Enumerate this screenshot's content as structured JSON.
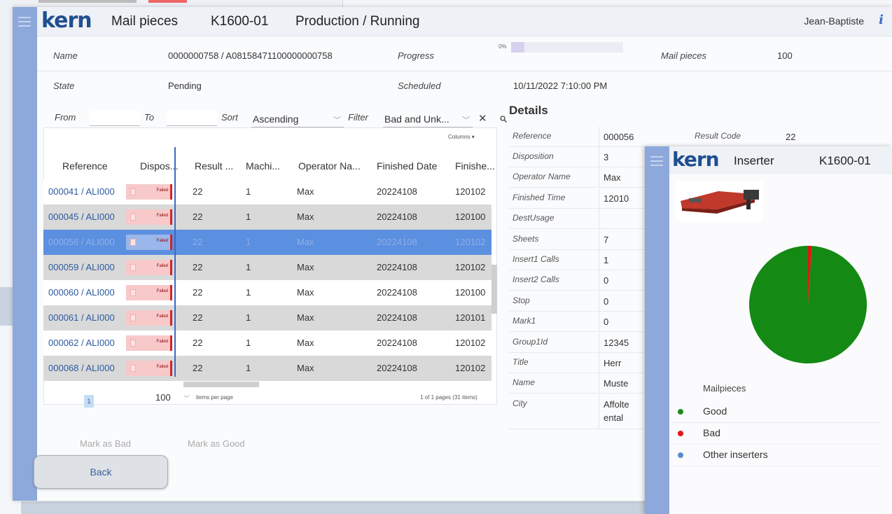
{
  "app": {
    "logo": "kern",
    "section": "Mail pieces",
    "machine": "K1600-01",
    "status": "Production / Running",
    "user": "Jean-Baptiste",
    "info_icon": "i"
  },
  "job": {
    "name_label": "Name",
    "name_value": "0000000758 / A08158471100000000758",
    "progress_label": "Progress",
    "progress_text": "0%",
    "progress_value": 0.12,
    "mailpieces_label": "Mail pieces",
    "mailpieces_value": "100",
    "state_label": "State",
    "state_value": "Pending",
    "scheduled_label": "Scheduled",
    "scheduled_value": "10/11/2022 7:10:00 PM"
  },
  "filter": {
    "from_label": "From",
    "to_label": "To",
    "sort_label": "Sort",
    "sort_value": "Ascending",
    "filter_label": "Filter",
    "filter_value": "Bad and Unk...",
    "clear_icon": "✕",
    "search_icon": "magnifier"
  },
  "grid": {
    "columns_button": "Columns",
    "headers": [
      "Reference",
      "Dispos...",
      "Result ...",
      "Machi...",
      "Operator Na...",
      "Finished Date",
      "Finishe..."
    ],
    "rows": [
      {
        "ref": "000041 / ALI000",
        "disp": "Failed",
        "result": "22",
        "machine": "1",
        "operator": "Max",
        "date": "20224108",
        "time": "120102"
      },
      {
        "ref": "000045 / ALI000",
        "disp": "Failed",
        "result": "22",
        "machine": "1",
        "operator": "Max",
        "date": "20224108",
        "time": "120100"
      },
      {
        "ref": "000056 / ALI000",
        "disp": "Failed",
        "result": "22",
        "machine": "1",
        "operator": "Max",
        "date": "20224108",
        "time": "120102"
      },
      {
        "ref": "000059 / ALI000",
        "disp": "Failed",
        "result": "22",
        "machine": "1",
        "operator": "Max",
        "date": "20224108",
        "time": "120102"
      },
      {
        "ref": "000060 / ALI000",
        "disp": "Failed",
        "result": "22",
        "machine": "1",
        "operator": "Max",
        "date": "20224108",
        "time": "120100"
      },
      {
        "ref": "000061 / ALI000",
        "disp": "Failed",
        "result": "22",
        "machine": "1",
        "operator": "Max",
        "date": "20224108",
        "time": "120101"
      },
      {
        "ref": "000062 / ALI000",
        "disp": "Failed",
        "result": "22",
        "machine": "1",
        "operator": "Max",
        "date": "20224108",
        "time": "120102"
      },
      {
        "ref": "000068 / ALI000",
        "disp": "Failed",
        "result": "22",
        "machine": "1",
        "operator": "Max",
        "date": "20224108",
        "time": "120102"
      }
    ],
    "selected_index": 2,
    "pager": {
      "page": "1",
      "page_size": "100",
      "items_per_page": "items per page",
      "info": "1 of 1 pages (31 items)"
    }
  },
  "actions": {
    "mark_bad": "Mark as Bad",
    "mark_good": "Mark as Good",
    "back": "Back"
  },
  "details": {
    "title": "Details",
    "ref_label": "Reference",
    "ref_value": "000056",
    "result_code_label": "Result Code",
    "result_code_value": "22",
    "rows": [
      {
        "k": "Disposition",
        "v": "3"
      },
      {
        "k": "Operator Name",
        "v": "Max"
      },
      {
        "k": "Finished Time",
        "v": "12010"
      },
      {
        "k": "DestUsage",
        "v": ""
      },
      {
        "k": "Sheets",
        "v": "7"
      },
      {
        "k": "Insert1 Calls",
        "v": "1"
      },
      {
        "k": "Insert2 Calls",
        "v": "0"
      },
      {
        "k": "Stop",
        "v": "0"
      },
      {
        "k": "Mark1",
        "v": "0"
      },
      {
        "k": "Group1Id",
        "v": "12345"
      },
      {
        "k": "Title",
        "v": "Herr"
      },
      {
        "k": "Name",
        "v": "Muste"
      },
      {
        "k": "City",
        "v": "Affolte",
        "v2": "ental"
      }
    ]
  },
  "inserter": {
    "logo": "kern",
    "title": "Inserter",
    "machine": "K1600-01",
    "legend_title": "Mailpieces",
    "legend": [
      {
        "label": "Good",
        "color": "#1e8a1e"
      },
      {
        "label": "Bad",
        "color": "#e01515"
      },
      {
        "label": "Other inserters",
        "color": "#5b8ccf"
      }
    ],
    "pie": {
      "good": 0.99,
      "bad": 0.01
    }
  }
}
